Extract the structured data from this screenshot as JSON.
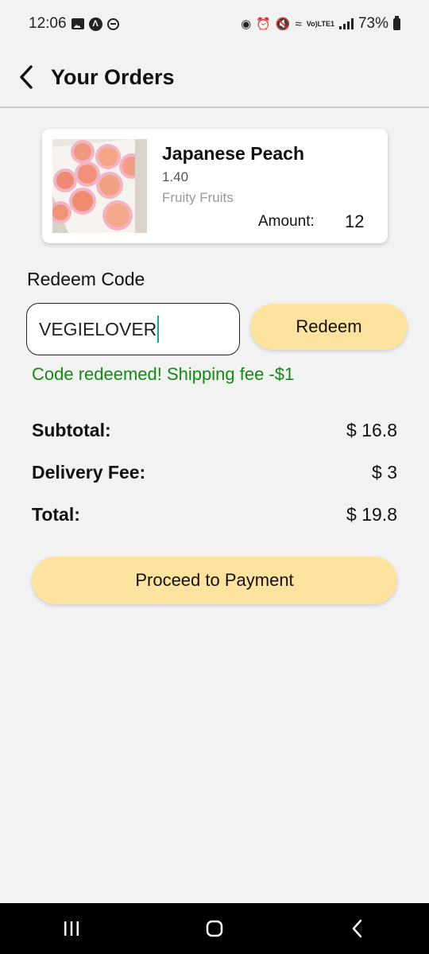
{
  "status_bar": {
    "time": "12:06",
    "battery": "73%",
    "network": "LTE1"
  },
  "header": {
    "title": "Your Orders"
  },
  "product": {
    "name": "Japanese Peach",
    "price": "1.40",
    "category": "Fruity Fruits",
    "amount_label": "Amount:",
    "amount_value": "12"
  },
  "redeem": {
    "heading": "Redeem Code",
    "code_value": "VEGIELOVER",
    "button_label": "Redeem",
    "message": "Code redeemed! Shipping fee  -$1"
  },
  "summary": {
    "subtotal_label": "Subtotal:",
    "subtotal_value": "$ 16.8",
    "delivery_label": "Delivery Fee:",
    "delivery_value": "$ 3",
    "total_label": "Total:",
    "total_value": "$ 19.8"
  },
  "payment": {
    "button_label": "Proceed to Payment"
  },
  "colors": {
    "accent_button": "#fde39e",
    "success_text": "#138a13",
    "caret": "#1aa39a"
  }
}
